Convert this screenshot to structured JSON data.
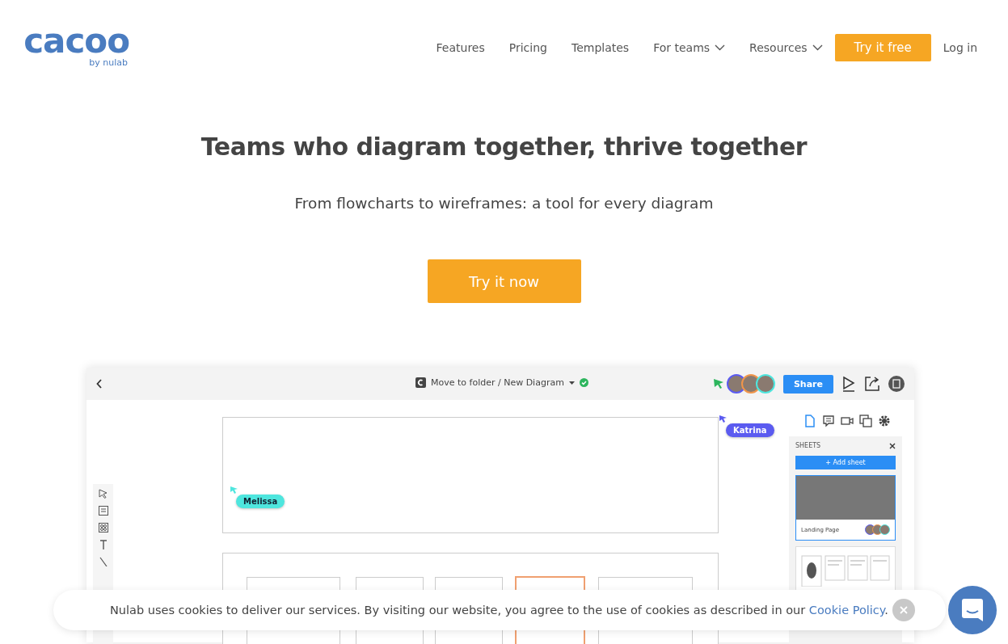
{
  "logo": {
    "wordmark": "cacoo",
    "byline": "by nulab"
  },
  "nav": [
    {
      "label": "Features",
      "kind": "link"
    },
    {
      "label": "Pricing",
      "kind": "link"
    },
    {
      "label": "Templates",
      "kind": "link"
    },
    {
      "label": "For teams",
      "kind": "dropdown"
    },
    {
      "label": "Resources",
      "kind": "dropdown"
    },
    {
      "label": "Try it free",
      "kind": "cta"
    },
    {
      "label": "Log in",
      "kind": "link"
    }
  ],
  "hero": {
    "title": "Teams who diagram together, thrive together",
    "subtitle": "From flowcharts to wireframes: a tool for every diagram",
    "button": "Try it now"
  },
  "app_preview": {
    "breadcrumb": "Move to folder / New Diagram",
    "saved": true,
    "share_button": "Share",
    "cursors": [
      {
        "name": "Katrina",
        "color": "#5b5bf0"
      },
      {
        "name": "Melissa",
        "color": "#4ee6de"
      }
    ],
    "sheets_panel": {
      "title": "SHEETS",
      "add_button": "+ Add sheet",
      "sheets": [
        {
          "name": "Landing Page",
          "selected": true
        },
        {
          "selected": false
        }
      ]
    }
  },
  "cookie_banner": {
    "text": "Nulab uses cookies to deliver our services. By visiting our website, you agree to the use of cookies as described in our ",
    "link": "Cookie Policy",
    "after": "."
  }
}
